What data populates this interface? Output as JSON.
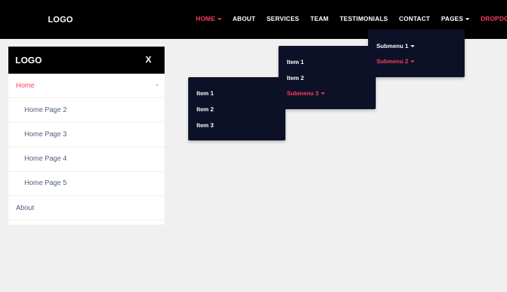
{
  "navbar": {
    "logo": "LOGO",
    "items": [
      {
        "label": "HOME",
        "active": true,
        "caret": true
      },
      {
        "label": "ABOUT"
      },
      {
        "label": "SERVICES"
      },
      {
        "label": "TEAM"
      },
      {
        "label": "TESTIMONIALS"
      },
      {
        "label": "CONTACT"
      },
      {
        "label": "PAGES",
        "caret": true
      },
      {
        "label": "DROPDOWN",
        "active": true,
        "caret": true
      }
    ]
  },
  "dropdowns": {
    "level1": {
      "items": [
        {
          "label": "Submenu 1",
          "caret": true
        },
        {
          "label": "Submenu 2",
          "caret": true,
          "active": true
        }
      ]
    },
    "level2": {
      "items": [
        {
          "label": "Item 1"
        },
        {
          "label": "Item 2"
        },
        {
          "label": "Submenu 3",
          "caret": true,
          "active": true
        }
      ]
    },
    "level3": {
      "items": [
        {
          "label": "Item 1"
        },
        {
          "label": "Item 2"
        },
        {
          "label": "Item 3"
        }
      ]
    }
  },
  "sidebar": {
    "logo": "LOGO",
    "close_label": "X",
    "items": [
      {
        "label": "Home",
        "active": true,
        "toggle": "-"
      },
      {
        "label": "Home Page 2"
      },
      {
        "label": "Home Page 3"
      },
      {
        "label": "Home Page 4"
      },
      {
        "label": "Home Page 5"
      },
      {
        "label": "About"
      }
    ]
  },
  "colors": {
    "accent": "#ff3b5c",
    "navbar_bg": "#000000",
    "dropdown_bg": "#0d1128",
    "sidebar_text": "#4c5b7d",
    "page_bg": "#f0f0f0"
  }
}
